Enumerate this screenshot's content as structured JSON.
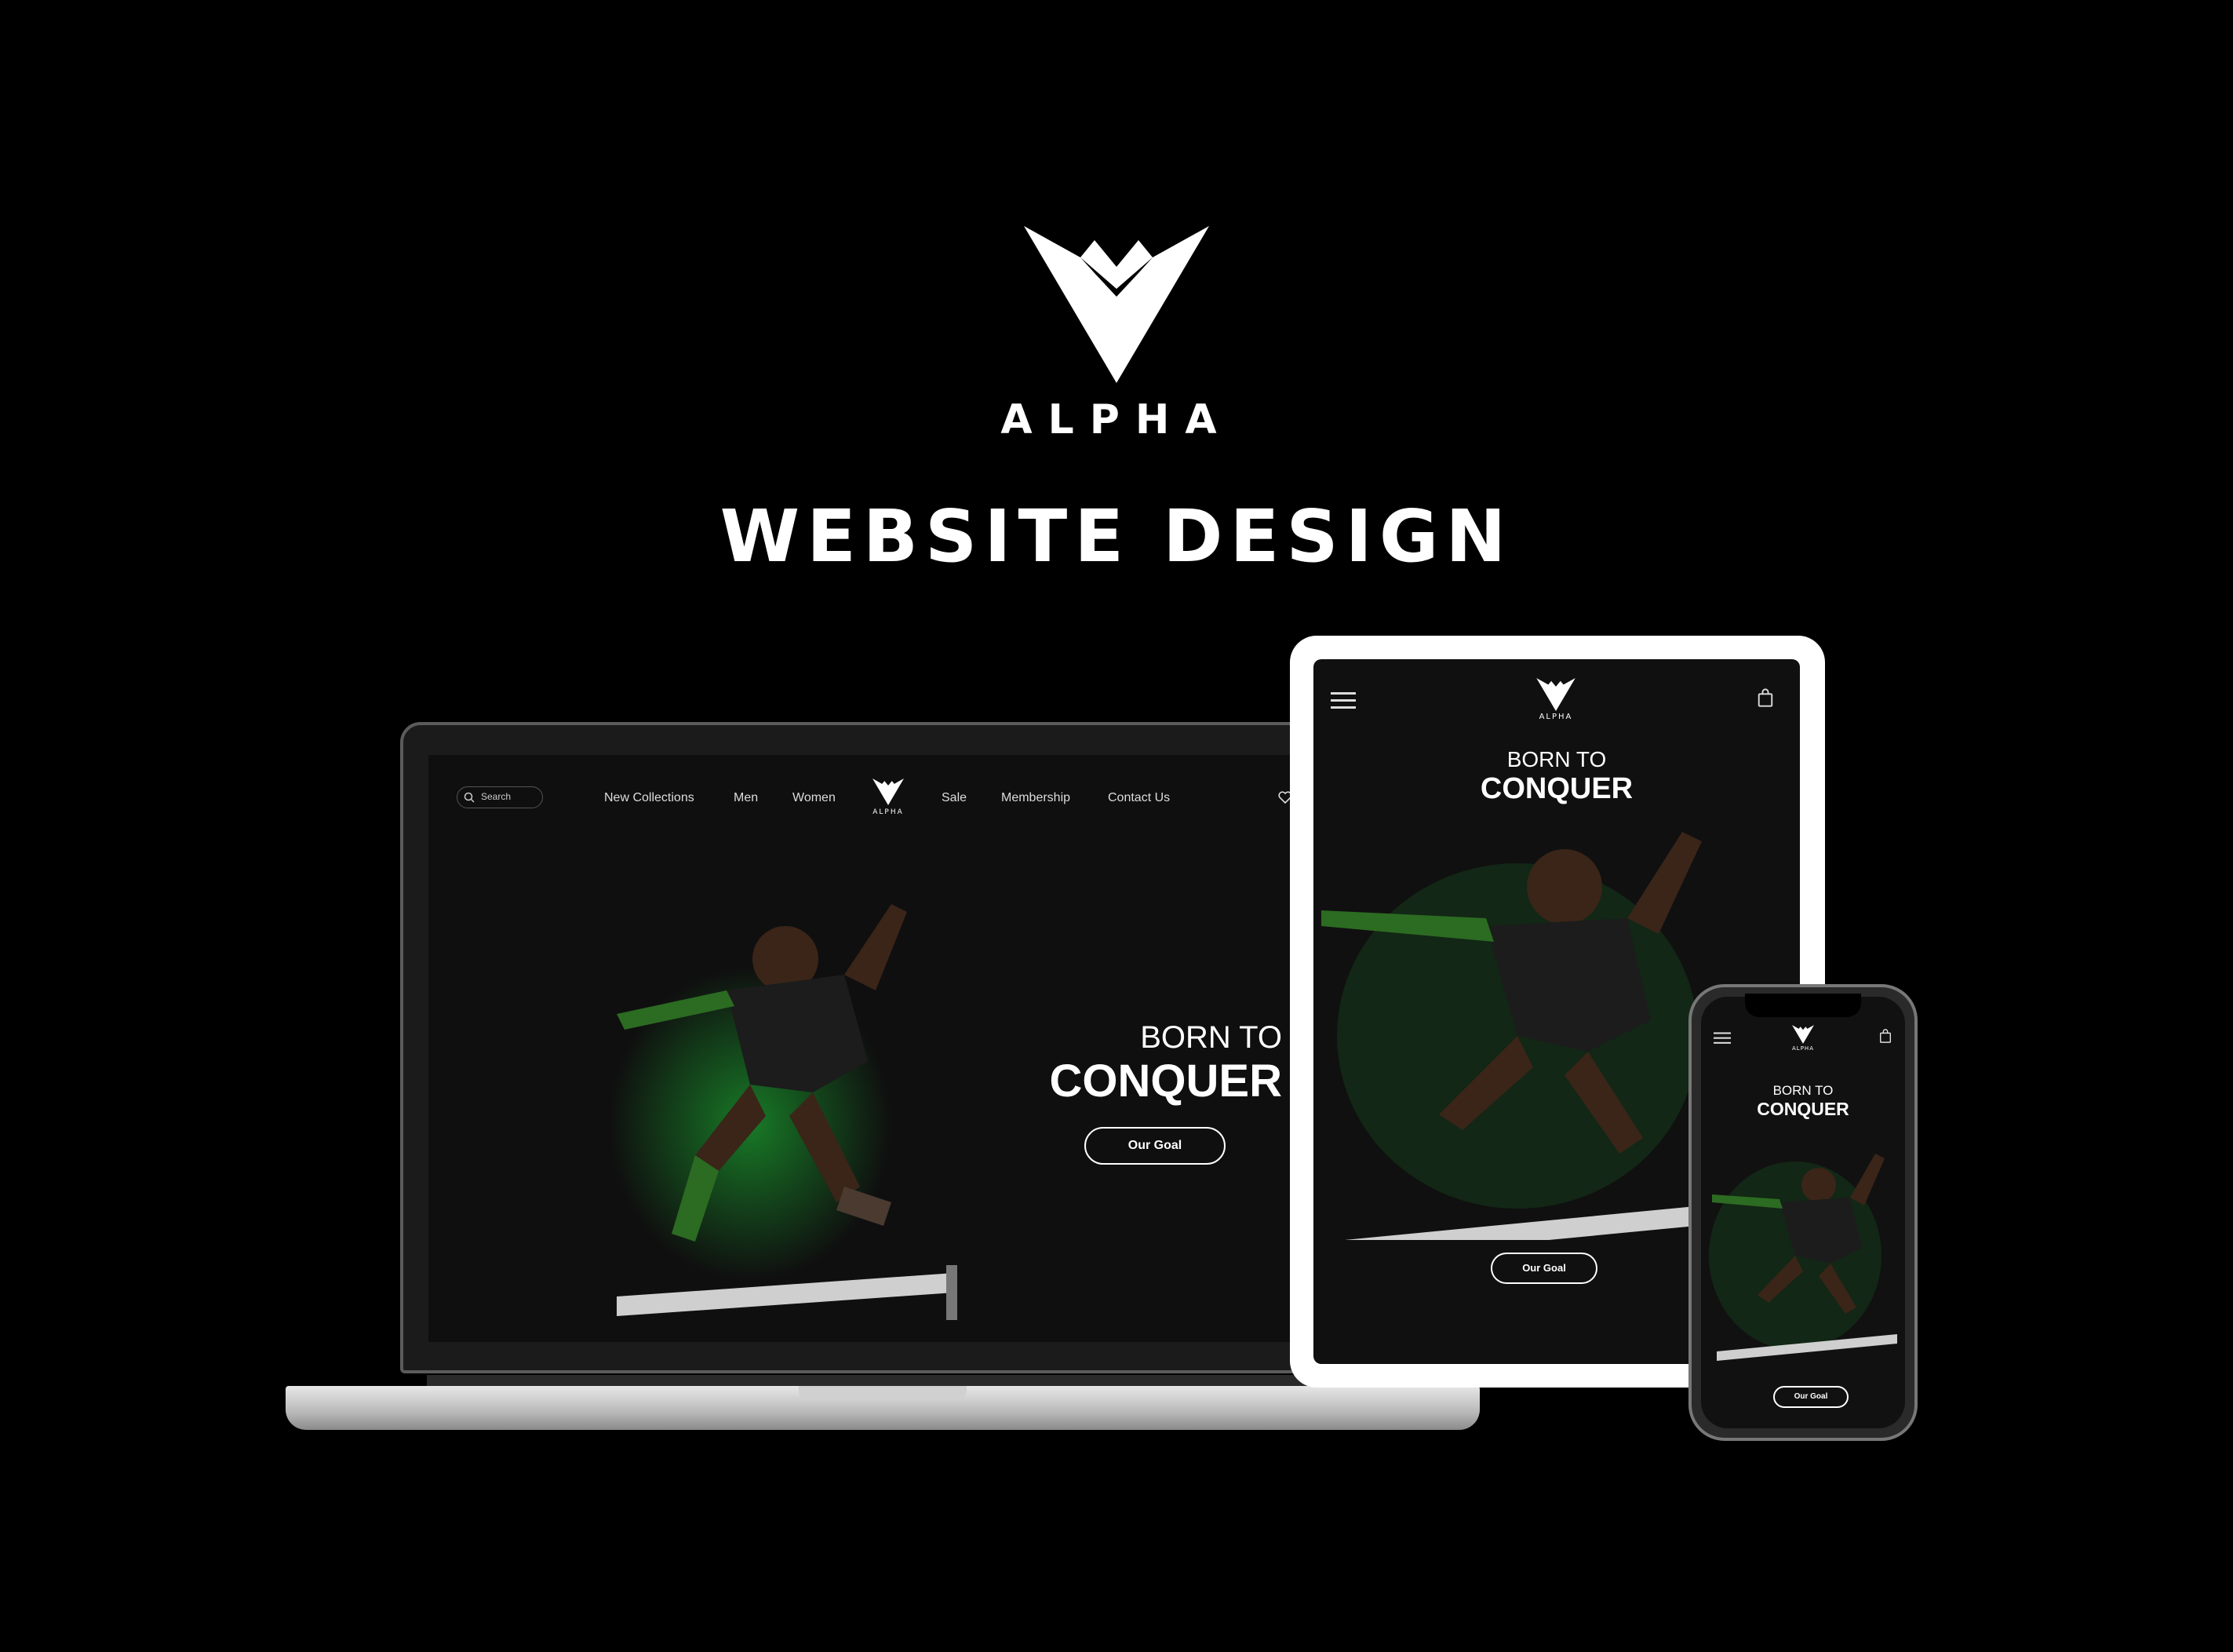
{
  "brand": {
    "name": "ALPHA",
    "title": "WEBSITE DESIGN"
  },
  "desktop": {
    "search_placeholder": "Search",
    "nav": [
      "New Collections",
      "Men",
      "Women",
      "Sale",
      "Membership",
      "Contact Us"
    ],
    "logo_text": "ALPHA",
    "hero_line1": "BORN TO",
    "hero_line2": "CONQUER",
    "cta": "Our Goal"
  },
  "tablet": {
    "logo_text": "ALPHA",
    "hero_line1": "BORN TO",
    "hero_line2": "CONQUER",
    "cta": "Our Goal"
  },
  "phone": {
    "logo_text": "ALPHA",
    "hero_line1": "BORN TO",
    "hero_line2": "CONQUER",
    "cta": "Our Goal"
  },
  "colors": {
    "background": "#000000",
    "accent_green": "#1fd13a",
    "text": "#ffffff"
  },
  "icons": [
    "search-icon",
    "heart-icon",
    "bag-icon",
    "hamburger-icon",
    "alpha-logo-icon"
  ]
}
